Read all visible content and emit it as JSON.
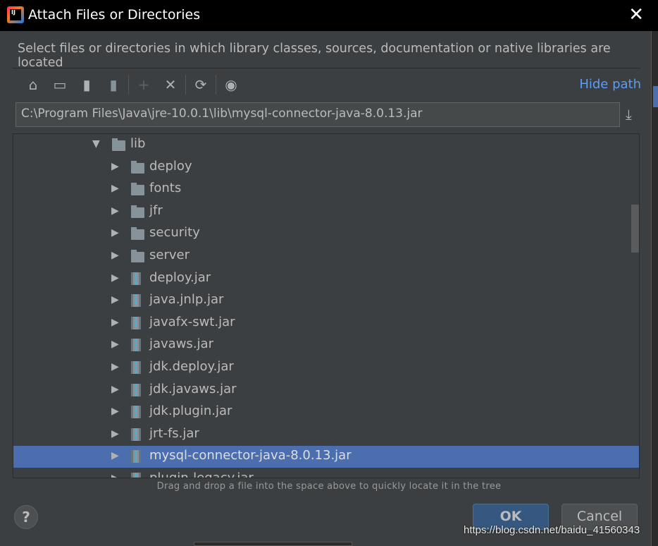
{
  "window": {
    "title": "Attach Files or Directories",
    "close_icon": "close-icon"
  },
  "description": "Select files or directories in which library classes, sources, documentation or native libraries are located",
  "toolbar": {
    "buttons": [
      {
        "name": "home-icon",
        "glyph": "⌂"
      },
      {
        "name": "desktop-icon",
        "glyph": "▭"
      },
      {
        "name": "project-folder-icon",
        "glyph": "▮"
      },
      {
        "name": "module-folder-icon",
        "glyph": "▮"
      },
      {
        "name": "new-folder-icon",
        "glyph": "+"
      },
      {
        "name": "delete-icon",
        "glyph": "✕"
      },
      {
        "name": "refresh-icon",
        "glyph": "⟳"
      },
      {
        "name": "show-hidden-icon",
        "glyph": "◉"
      }
    ],
    "hide_path": "Hide path"
  },
  "path": {
    "value": "C:\\Program Files\\Java\\jre-10.0.1\\lib\\mysql-connector-java-8.0.13.jar"
  },
  "tree": {
    "items": [
      {
        "label": "lib",
        "type": "folder",
        "expanded": true,
        "level": 0
      },
      {
        "label": "deploy",
        "type": "folder",
        "level": 1
      },
      {
        "label": "fonts",
        "type": "folder",
        "level": 1
      },
      {
        "label": "jfr",
        "type": "folder",
        "level": 1
      },
      {
        "label": "security",
        "type": "folder",
        "level": 1
      },
      {
        "label": "server",
        "type": "folder",
        "level": 1
      },
      {
        "label": "deploy.jar",
        "type": "jar",
        "level": 1
      },
      {
        "label": "java.jnlp.jar",
        "type": "jar",
        "level": 1
      },
      {
        "label": "javafx-swt.jar",
        "type": "jar",
        "level": 1
      },
      {
        "label": "javaws.jar",
        "type": "jar",
        "level": 1
      },
      {
        "label": "jdk.deploy.jar",
        "type": "jar",
        "level": 1
      },
      {
        "label": "jdk.javaws.jar",
        "type": "jar",
        "level": 1
      },
      {
        "label": "jdk.plugin.jar",
        "type": "jar",
        "level": 1
      },
      {
        "label": "jrt-fs.jar",
        "type": "jar",
        "level": 1
      },
      {
        "label": "mysql-connector-java-8.0.13.jar",
        "type": "jar",
        "level": 1,
        "selected": true
      },
      {
        "label": "plugin-legacy.jar",
        "type": "jar",
        "level": 1
      }
    ]
  },
  "hint": "Drag and drop a file into the space above to quickly locate it in the tree",
  "buttons": {
    "help": "?",
    "ok": "OK",
    "cancel": "Cancel"
  },
  "watermark": "https://blog.csdn.net/baidu_41560343",
  "colors": {
    "selection": "#4b6eaf",
    "link": "#589df6",
    "ok_button": "#365880"
  }
}
